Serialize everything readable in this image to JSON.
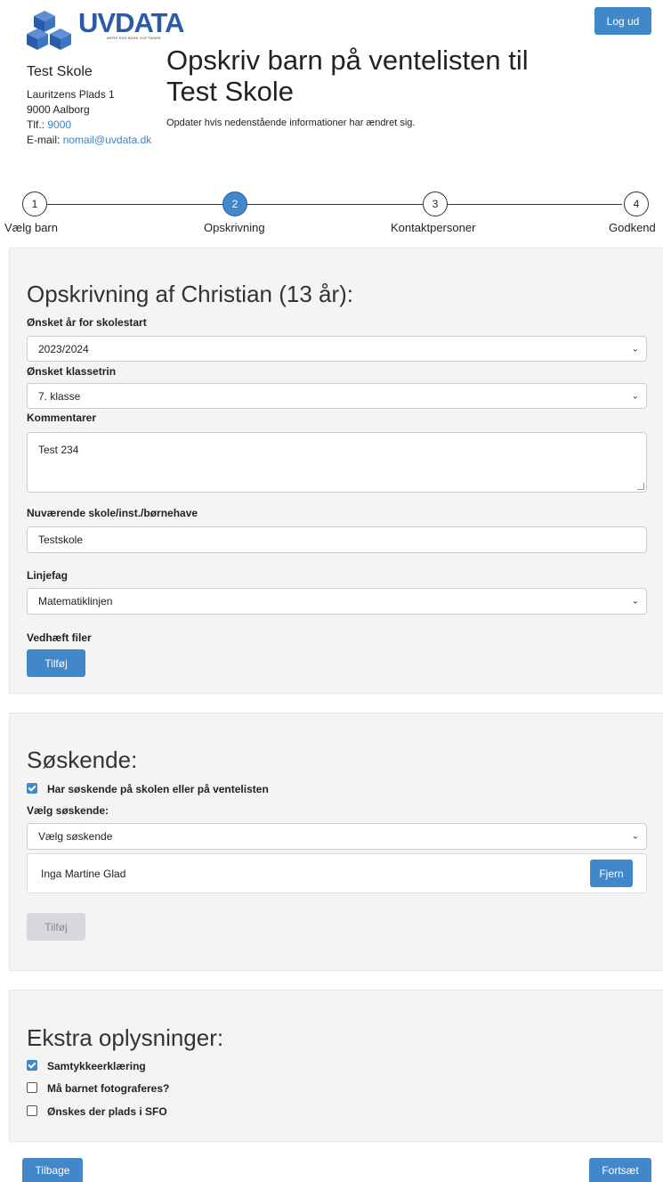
{
  "header": {
    "logo_text": "UVDATA",
    "logo_tagline": "MERE END BARE SOFTWARE",
    "school_name": "Test Skole",
    "address": "Lauritzens Plads 1",
    "city": "9000 Aalborg",
    "phone_label": "Tlf.:",
    "phone": "9000",
    "email_label": "E-mail:",
    "email": "nomail@uvdata.dk",
    "title": "Opskriv barn på ventelisten til Test Skole",
    "subtitle": "Opdater hvis nedenstående informationer har ændret sig.",
    "logout_label": "Log ud"
  },
  "steps": [
    {
      "number": "1",
      "label": "Vælg barn"
    },
    {
      "number": "2",
      "label": "Opskrivning",
      "active": true
    },
    {
      "number": "3",
      "label": "Kontaktpersoner"
    },
    {
      "number": "4",
      "label": "Godkend"
    }
  ],
  "registration": {
    "heading": "Opskrivning af Christian (13 år):",
    "start_year_label": "Ønsket år for skolestart",
    "start_year_value": "2023/2024",
    "grade_label": "Ønsket klassetrin",
    "grade_value": "7. klasse",
    "comments_label": "Kommentarer",
    "comments_value": "Test 234",
    "current_school_label": "Nuværende skole/inst./børnehave",
    "current_school_value": "Testskole",
    "line_subject_label": "Linjefag",
    "line_subject_value": "Matematiklinjen",
    "attach_label": "Vedhæft filer",
    "add_button": "Tilføj"
  },
  "siblings": {
    "heading": "Søskende:",
    "has_siblings_label": "Har søskende på skolen eller på ventelisten",
    "has_siblings_checked": true,
    "choose_label": "Vælg søskende:",
    "choose_value": "Vælg søskende",
    "selected_sibling": "Inga Martine Glad",
    "remove_button": "Fjern",
    "add_button": "Tilføj"
  },
  "extra": {
    "heading": "Ekstra oplysninger:",
    "options": [
      {
        "label": "Samtykkeerklæring",
        "checked": true
      },
      {
        "label": "Må barnet fotograferes?",
        "checked": false
      },
      {
        "label": "Ønskes der plads i SFO",
        "checked": false
      }
    ]
  },
  "footer": {
    "back_label": "Tilbage",
    "next_label": "Fortsæt"
  },
  "colors": {
    "accent": "#4287c9",
    "brand": "#2b5aa9",
    "panel_bg": "#f4f4f4"
  }
}
